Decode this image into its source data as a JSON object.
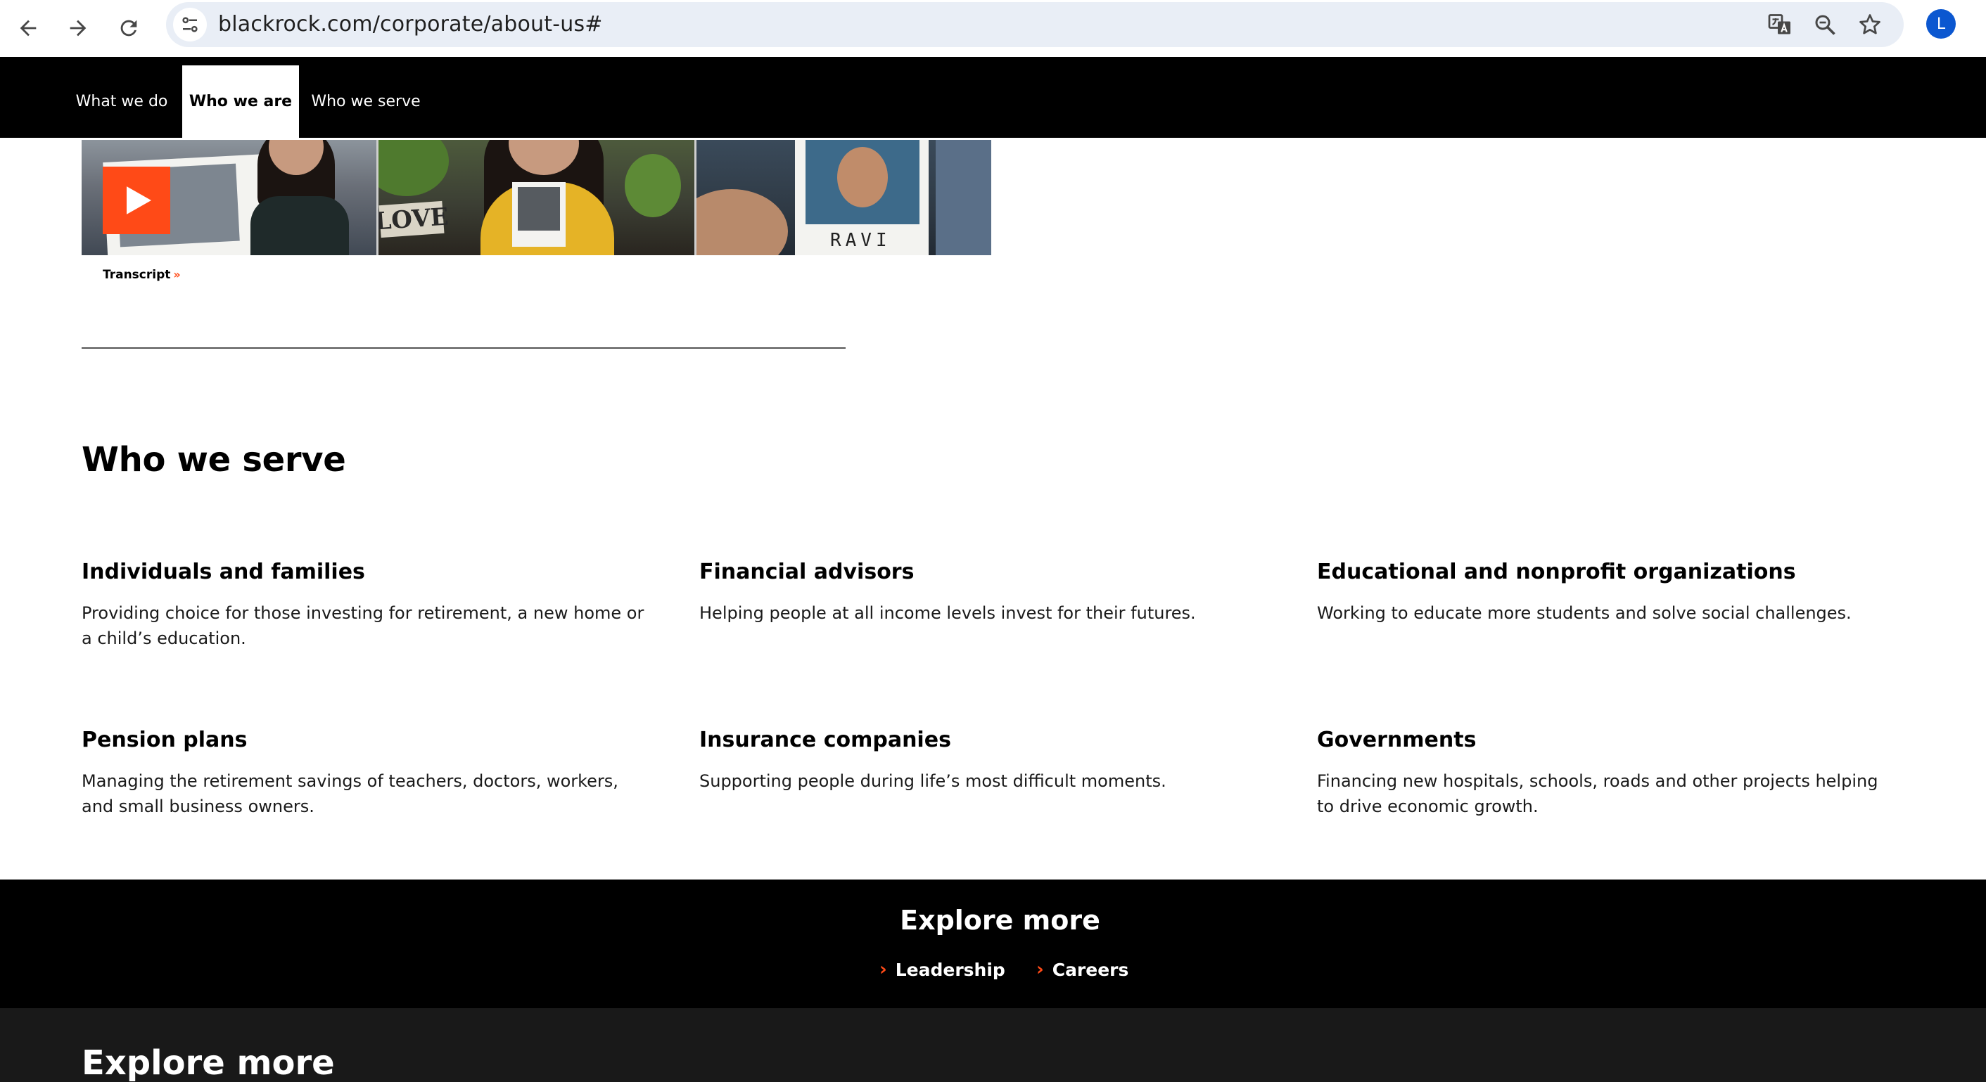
{
  "browser": {
    "url": "blackrock.com/corporate/about-us#",
    "avatar_initial": "L"
  },
  "site_nav": {
    "tabs": [
      {
        "label": "What we do"
      },
      {
        "label": "Who we are"
      },
      {
        "label": "Who we serve"
      }
    ]
  },
  "video": {
    "frame1_sign": "LOVE",
    "frame3_name": "RAVI",
    "transcript_label": "Transcript",
    "accent_color": "#ff4a17"
  },
  "who_we_serve": {
    "title": "Who we serve",
    "cards": [
      {
        "title": "Individuals and families",
        "text": "Providing choice for those investing for retirement, a new home or a child’s education."
      },
      {
        "title": "Financial advisors",
        "text": "Helping people at all income levels invest for their futures."
      },
      {
        "title": "Educational and nonprofit organizations",
        "text": "Working to educate more students and solve social challenges."
      },
      {
        "title": "Pension plans",
        "text": "Managing the retirement savings of teachers, doctors, workers, and small business owners."
      },
      {
        "title": "Insurance companies",
        "text": "Supporting people during life’s most difficult moments."
      },
      {
        "title": "Governments",
        "text": "Financing new hospitals, schools, roads and other projects helping to drive economic growth."
      }
    ]
  },
  "explore_band": {
    "title": "Explore more",
    "links": [
      {
        "label": "Leadership"
      },
      {
        "label": "Careers"
      }
    ]
  },
  "footer": {
    "title": "Explore more"
  }
}
